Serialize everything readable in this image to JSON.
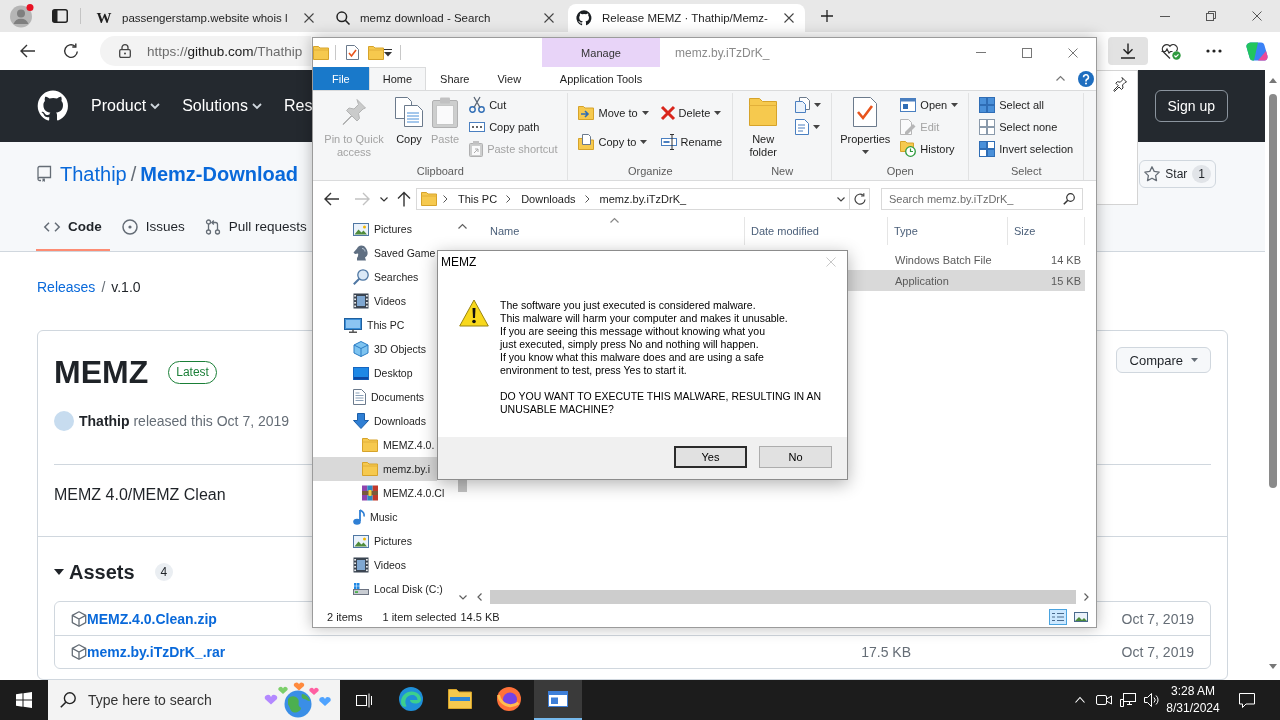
{
  "browser": {
    "tabs": [
      {
        "kind": "letter",
        "favicon": "W",
        "title": "passengerstamp.website whois l",
        "selected": false
      },
      {
        "kind": "search",
        "title": "memz download - Search",
        "selected": false
      },
      {
        "kind": "site",
        "title": "Release MEMZ · Thathip/Memz-",
        "selected": true
      }
    ],
    "url": {
      "scheme": "https://",
      "host": "github.com",
      "path": "/Thathip"
    }
  },
  "github": {
    "nav": [
      {
        "label": "Product",
        "menu": true
      },
      {
        "label": "Solutions",
        "menu": true
      },
      {
        "label": "Res"
      }
    ],
    "sign_up": "Sign up",
    "repo": {
      "owner": "Thathip",
      "separator": "/",
      "name": "Memz-Download"
    },
    "star": {
      "label": "Star",
      "count": "1"
    },
    "tabs": [
      {
        "kind": "code",
        "label": "Code",
        "selected": true
      },
      {
        "kind": "issues",
        "label": "Issues",
        "selected": false
      },
      {
        "kind": "pulls",
        "label": "Pull requests",
        "selected": false
      }
    ],
    "breadcrumb": {
      "link": "Releases",
      "separator": "/",
      "current": "v.1.0"
    },
    "release": {
      "title": "MEMZ",
      "badge": "Latest",
      "compare": "Compare",
      "author": "Thathip",
      "released": "released this Oct 7, 2019",
      "description": "MEMZ 4.0/MEMZ Clean",
      "assets_label": "Assets",
      "assets_count": "4",
      "assets": [
        {
          "name": "MEMZ.4.0.Clean.zip",
          "date": "Oct 7, 2019"
        },
        {
          "name": "memz.by.iTzDrK_.rar",
          "size": "17.5 KB",
          "date": "Oct 7, 2019"
        }
      ]
    }
  },
  "explorer": {
    "title": "memz.by.iTzDrK_",
    "context_label": "Manage",
    "tabs": [
      {
        "kind": "file",
        "label": "File",
        "selected": false
      },
      {
        "kind": "tab",
        "label": "Home",
        "selected": true
      },
      {
        "kind": "tab",
        "label": "Share",
        "selected": false
      },
      {
        "kind": "tab",
        "label": "View",
        "selected": false
      },
      {
        "kind": "context",
        "label": "Application Tools",
        "selected": false
      }
    ],
    "groups": [
      {
        "label": "Clipboard",
        "items": [
          {
            "kind": "pin",
            "label": "Pin to Quick access",
            "disabled": true,
            "menu": false
          },
          {
            "kind": "copy",
            "label": "Copy",
            "disabled": false,
            "menu": false
          },
          {
            "kind": "paste",
            "label": "Paste",
            "disabled": true,
            "menu": false
          },
          {
            "kind": "cut",
            "label": "Cut",
            "disabled": false,
            "menu": false
          },
          {
            "kind": "copypath",
            "label": "Copy path",
            "disabled": false,
            "menu": false
          },
          {
            "kind": "pasteshortcut",
            "label": "Paste shortcut",
            "disabled": true,
            "menu": false
          }
        ]
      },
      {
        "label": "Organize",
        "items": [
          {
            "kind": "moveto",
            "label": "Move to",
            "disabled": false,
            "menu": true
          },
          {
            "kind": "copyto",
            "label": "Copy to",
            "disabled": false,
            "menu": true
          },
          {
            "kind": "delete",
            "label": "Delete",
            "disabled": false,
            "menu": true
          },
          {
            "kind": "rename",
            "label": "Rename",
            "disabled": false,
            "menu": false
          }
        ]
      },
      {
        "label": "New",
        "items": [
          {
            "kind": "newfolder",
            "label": "New folder",
            "disabled": false,
            "menu": false
          },
          {
            "kind": "newitem",
            "disabled": false,
            "menu": true
          },
          {
            "kind": "easyaccess",
            "disabled": false,
            "menu": true
          }
        ]
      },
      {
        "label": "Open",
        "items": [
          {
            "kind": "properties",
            "label": "Properties",
            "disabled": false,
            "menu": true
          },
          {
            "kind": "open",
            "label": "Open",
            "disabled": false,
            "menu": true
          },
          {
            "kind": "edit",
            "label": "Edit",
            "disabled": true,
            "menu": false
          },
          {
            "kind": "history",
            "label": "History",
            "disabled": false,
            "menu": false
          }
        ]
      },
      {
        "label": "Select",
        "items": [
          {
            "kind": "selectall",
            "label": "Select all",
            "disabled": false,
            "menu": false
          },
          {
            "kind": "selectnone",
            "label": "Select none",
            "disabled": false,
            "menu": false
          },
          {
            "kind": "invert",
            "label": "Invert selection",
            "disabled": false,
            "menu": false
          }
        ]
      }
    ],
    "nav_buttons": [
      {
        "kind": "back",
        "disabled": false
      },
      {
        "kind": "forward",
        "disabled": true
      },
      {
        "kind": "recent",
        "disabled": false
      },
      {
        "kind": "up",
        "disabled": false
      }
    ],
    "address": [
      "This PC",
      "Downloads",
      "memz.by.iTzDrK_"
    ],
    "search_placeholder": "Search memz.by.iTzDrK_",
    "tree": [
      {
        "children": [
          {
            "kind": "pictures",
            "label": "Pictures",
            "selected": false
          },
          {
            "kind": "games",
            "label": "Saved Game",
            "selected": false
          },
          {
            "kind": "searches",
            "label": "Searches",
            "selected": false
          },
          {
            "kind": "videos",
            "label": "Videos",
            "selected": false
          }
        ]
      },
      {
        "kind": "pc",
        "label": "This PC",
        "selected": false,
        "children": [
          {
            "kind": "objects",
            "label": "3D Objects",
            "selected": false
          },
          {
            "kind": "desktop",
            "label": "Desktop",
            "selected": false
          },
          {
            "kind": "documents",
            "label": "Documents",
            "selected": false
          },
          {
            "kind": "downloads",
            "label": "Downloads",
            "selected": false,
            "children": [
              {
                "kind": "folder",
                "label": "MEMZ.4.0.",
                "selected": false
              },
              {
                "kind": "folder",
                "label": "memz.by.i",
                "selected": true
              },
              {
                "kind": "archive",
                "label": "MEMZ.4.0.Cl",
                "selected": false
              }
            ]
          },
          {
            "kind": "music",
            "label": "Music",
            "selected": false
          },
          {
            "kind": "pictures",
            "label": "Pictures",
            "selected": false
          },
          {
            "kind": "videos",
            "label": "Videos",
            "selected": false
          },
          {
            "kind": "disk",
            "label": "Local Disk (C:)",
            "selected": false
          }
        ]
      }
    ],
    "columns": [
      {
        "label": "Name",
        "sorted": true
      },
      {
        "label": "Date modified",
        "sorted": false
      },
      {
        "label": "Type",
        "sorted": false
      },
      {
        "label": "Size",
        "sorted": false
      }
    ],
    "rows": [
      {
        "type": "Windows Batch File",
        "size": "14 KB",
        "selected": false
      },
      {
        "type": "Application",
        "size": "15 KB",
        "selected": true
      }
    ],
    "status": {
      "count": "2 items",
      "selection": "1 item selected",
      "size": "14.5 KB"
    },
    "views": [
      {
        "kind": "details",
        "selected": true
      },
      {
        "kind": "thumbnails",
        "selected": false
      }
    ]
  },
  "dialog": {
    "title": "MEMZ",
    "close_disabled": true,
    "message": "The software you just executed is considered malware.\nThis malware will harm your computer and makes it unusable.\nIf you are seeing this message without knowing what you\njust executed, simply press No and nothing will happen.\nIf you know what this malware does and are using a safe\nenvironment to test, press Yes to start it.",
    "question": "DO YOU WANT TO EXECUTE THIS MALWARE, RESULTING IN AN\nUNUSABLE MACHINE?",
    "buttons": [
      {
        "label": "Yes",
        "default": true
      },
      {
        "label": "No",
        "default": false
      }
    ]
  },
  "taskbar": {
    "search_placeholder": "Type here to search",
    "apps": [
      {
        "kind": "swirl",
        "selected": false
      },
      {
        "kind": "folder",
        "selected": false
      },
      {
        "kind": "fox",
        "selected": false
      },
      {
        "kind": "window",
        "selected": true
      }
    ],
    "time": "3:28 AM",
    "date": "8/31/2024"
  }
}
